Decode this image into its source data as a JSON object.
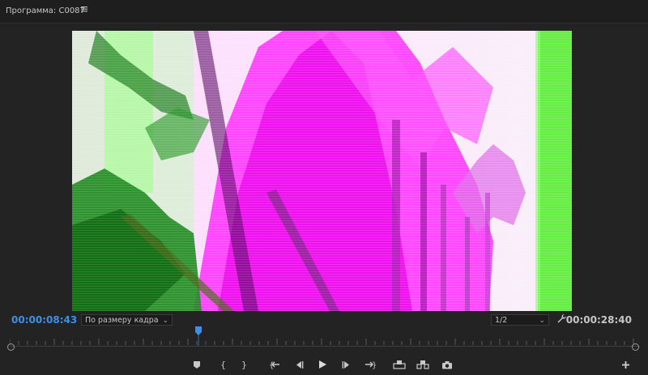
{
  "panel": {
    "title": "Программа: C0087"
  },
  "viewer": {
    "current_timecode": "00:00:08:43",
    "duration_timecode": "00:00:28:40",
    "fit_select": "По размеру кадра",
    "resolution_select": "1/2",
    "playback_progress": 0.3
  },
  "icons": {
    "panel_menu": "hamburger-icon",
    "settings": "wrench-icon",
    "add_button": "plus-icon",
    "transport": [
      "marker-icon",
      "mark-in-icon",
      "mark-out-icon",
      "go-to-in-icon",
      "step-back-icon",
      "play-icon",
      "step-forward-icon",
      "go-to-out-icon",
      "lift-icon",
      "extract-icon",
      "camera-icon"
    ]
  },
  "colors": {
    "timecode_accent": "#3c91e6",
    "panel_bg": "#232323"
  }
}
